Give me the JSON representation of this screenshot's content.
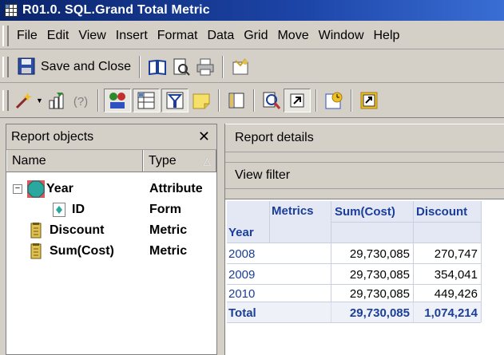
{
  "window": {
    "title": "R01.0. SQL.Grand Total Metric"
  },
  "menu": [
    "File",
    "Edit",
    "View",
    "Insert",
    "Format",
    "Data",
    "Grid",
    "Move",
    "Window",
    "Help"
  ],
  "toolbar": {
    "save_close_label": "Save and Close"
  },
  "report_objects": {
    "title": "Report objects",
    "columns": {
      "name": "Name",
      "type": "Type"
    },
    "items": [
      {
        "name": "Year",
        "type": "Attribute",
        "icon": "attribute-icon"
      },
      {
        "name": "ID",
        "type": "Form",
        "icon": "form-icon"
      },
      {
        "name": "Discount",
        "type": "Metric",
        "icon": "metric-icon"
      },
      {
        "name": "Sum(Cost)",
        "type": "Metric",
        "icon": "metric-icon"
      }
    ]
  },
  "report_details": {
    "label": "Report details"
  },
  "view_filter": {
    "label": "View filter"
  },
  "grid": {
    "metrics_header": "Metrics",
    "row_header": "Year",
    "columns": [
      "Sum(Cost)",
      "Discount"
    ],
    "rows": [
      {
        "label": "2008",
        "values": [
          "29,730,085",
          "270,747"
        ]
      },
      {
        "label": "2009",
        "values": [
          "29,730,085",
          "354,041"
        ]
      },
      {
        "label": "2010",
        "values": [
          "29,730,085",
          "449,426"
        ]
      }
    ],
    "total": {
      "label": "Total",
      "values": [
        "29,730,085",
        "1,074,214"
      ]
    }
  },
  "colors": {
    "titlebar": "#0a246a",
    "grid_header_text": "#1a3e99",
    "grid_header_bg": "#e3e8f4"
  }
}
